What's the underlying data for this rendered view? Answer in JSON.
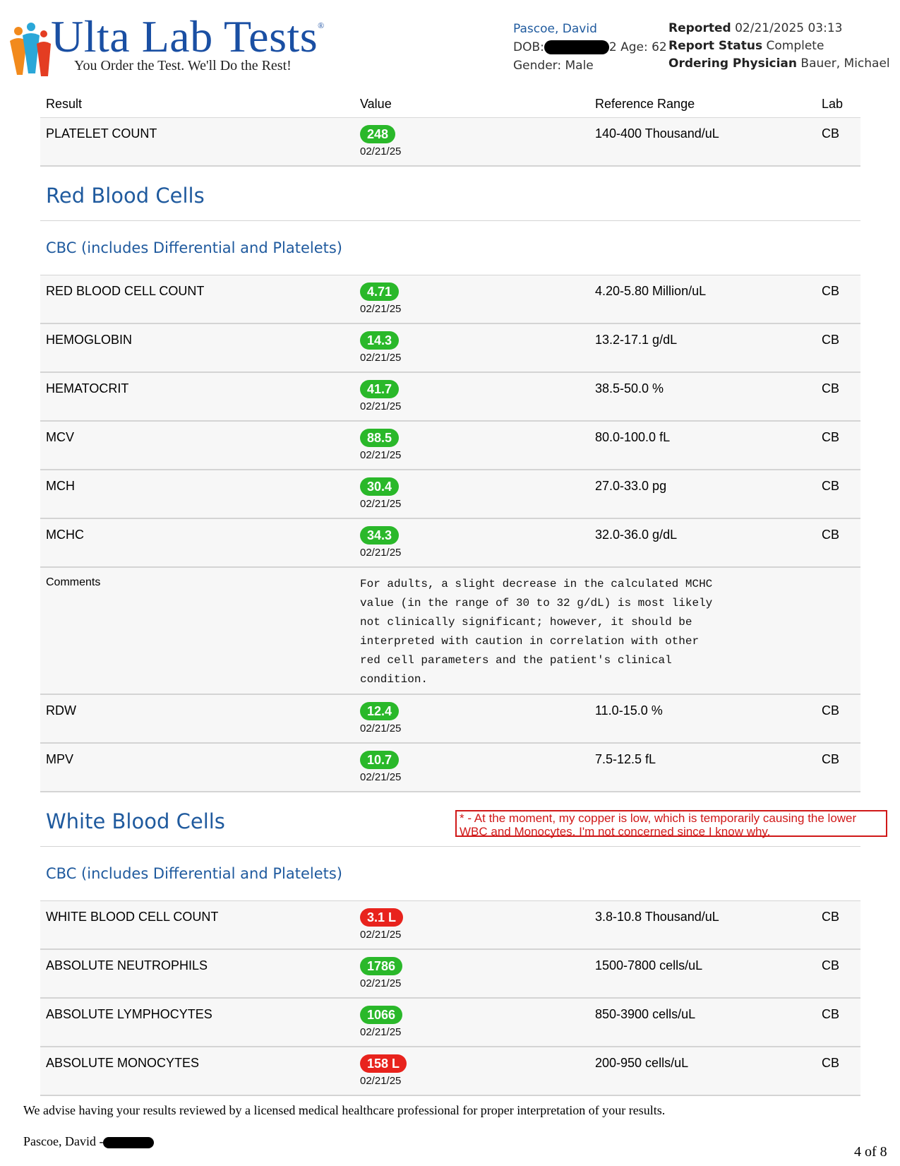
{
  "header": {
    "logo_title": "Ulta Lab Tests",
    "logo_tagline": "You Order the Test. We'll Do the Rest!",
    "patient_name": "Pascoe, David",
    "dob_label": "DOB:",
    "dob_tail": "2",
    "age": "Age: 62",
    "gender": "Gender: Male",
    "reported_label": "Reported",
    "reported_value": "02/21/2025 03:13",
    "status_label": "Report Status",
    "status_value": "Complete",
    "physician_label": "Ordering Physician",
    "physician_value": "Bauer, Michael"
  },
  "columns": {
    "result": "Result",
    "value": "Value",
    "reference": "Reference Range",
    "lab": "Lab"
  },
  "platelet": {
    "name": "PLATELET COUNT",
    "value": "248",
    "date": "02/21/25",
    "ref": "140-400 Thousand/uL",
    "lab": "CB",
    "flag": "normal"
  },
  "rbc_section": {
    "title": "Red Blood Cells",
    "panel": "CBC (includes Differential and Platelets)",
    "rows": [
      {
        "name": "RED BLOOD CELL COUNT",
        "value": "4.71",
        "date": "02/21/25",
        "ref": "4.20-5.80 Million/uL",
        "lab": "CB",
        "flag": "normal"
      },
      {
        "name": "HEMOGLOBIN",
        "value": "14.3",
        "date": "02/21/25",
        "ref": "13.2-17.1 g/dL",
        "lab": "CB",
        "flag": "normal"
      },
      {
        "name": "HEMATOCRIT",
        "value": "41.7",
        "date": "02/21/25",
        "ref": "38.5-50.0 %",
        "lab": "CB",
        "flag": "normal"
      },
      {
        "name": "MCV",
        "value": "88.5",
        "date": "02/21/25",
        "ref": "80.0-100.0 fL",
        "lab": "CB",
        "flag": "normal"
      },
      {
        "name": "MCH",
        "value": "30.4",
        "date": "02/21/25",
        "ref": "27.0-33.0 pg",
        "lab": "CB",
        "flag": "normal"
      },
      {
        "name": "MCHC",
        "value": "34.3",
        "date": "02/21/25",
        "ref": "32.0-36.0 g/dL",
        "lab": "CB",
        "flag": "normal"
      }
    ],
    "comment_label": "Comments",
    "comment_text": "For adults, a slight decrease in the calculated MCHC\nvalue (in the range of 30 to 32 g/dL) is most likely\nnot clinically significant; however, it should be\ninterpreted with caution in correlation with other\nred cell parameters and the patient's clinical\ncondition.",
    "rows_after": [
      {
        "name": "RDW",
        "value": "12.4",
        "date": "02/21/25",
        "ref": "11.0-15.0 %",
        "lab": "CB",
        "flag": "normal"
      },
      {
        "name": "MPV",
        "value": "10.7",
        "date": "02/21/25",
        "ref": "7.5-12.5 fL",
        "lab": "CB",
        "flag": "normal"
      }
    ]
  },
  "wbc_section": {
    "title": "White Blood Cells",
    "panel": "CBC (includes Differential and Platelets)",
    "note": " * - At the moment, my copper is low, which is temporarily causing the lower WBC and Monocytes. I'm not concerned since I know why.",
    "rows": [
      {
        "name": "WHITE BLOOD CELL COUNT",
        "value": "3.1 L",
        "date": "02/21/25",
        "ref": "3.8-10.8 Thousand/uL",
        "lab": "CB",
        "flag": "low"
      },
      {
        "name": "ABSOLUTE NEUTROPHILS",
        "value": "1786",
        "date": "02/21/25",
        "ref": "1500-7800 cells/uL",
        "lab": "CB",
        "flag": "normal"
      },
      {
        "name": "ABSOLUTE LYMPHOCYTES",
        "value": "1066",
        "date": "02/21/25",
        "ref": "850-3900 cells/uL",
        "lab": "CB",
        "flag": "normal"
      },
      {
        "name": "ABSOLUTE MONOCYTES",
        "value": "158 L",
        "date": "02/21/25",
        "ref": "200-950 cells/uL",
        "lab": "CB",
        "flag": "low"
      }
    ]
  },
  "footer": {
    "advice": "We advise having your results reviewed by a licensed medical healthcare professional for proper interpretation of your results.",
    "name": "Pascoe, David -",
    "page": "4 of 8"
  },
  "colors": {
    "normal": "#2ab82a",
    "low": "#e8231d",
    "accent": "#1f5a9e"
  }
}
